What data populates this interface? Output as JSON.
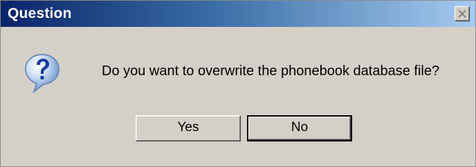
{
  "dialog": {
    "title": "Question",
    "message": "Do you want to overwrite the phonebook database file?",
    "icon": "question-icon",
    "close_icon": "close-icon",
    "buttons": {
      "yes_label": "Yes",
      "no_label": "No"
    },
    "default_button": "No"
  },
  "colors": {
    "titlebar_start": "#0a246a",
    "titlebar_end": "#a6caf0",
    "dialog_background": "#d4d0c8",
    "title_text": "#ffffff"
  }
}
